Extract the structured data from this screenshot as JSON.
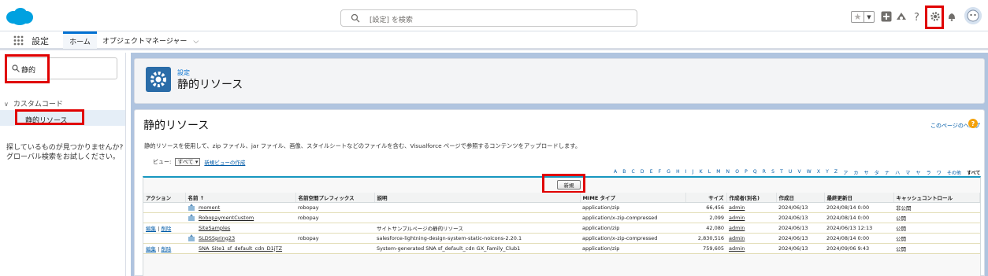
{
  "header": {
    "search_placeholder": "[設定] を検索"
  },
  "nav": {
    "app_name": "設定",
    "tabs": [
      {
        "label": "ホーム"
      },
      {
        "label": "オブジェクトマネージャー"
      }
    ]
  },
  "sidebar": {
    "quick_find_value": "静的",
    "section_label": "カスタムコード",
    "selected_item": "静的リソース",
    "help_text": "探しているものが見つかりませんか? グローバル検索をお試しください。"
  },
  "page_header": {
    "breadcrumb": "設定",
    "title": "静的リソース"
  },
  "main": {
    "title": "静的リソース",
    "help_link": "このページのヘルプ",
    "description": "静的リソースを使用して、zip ファイル、jar ファイル、画像、スタイルシートなどのファイルを含む、Visualforce ページで参照するコンテンツをアップロードします。",
    "view_label": "ビュー:",
    "view_value": "すべて",
    "new_view_link": "新規ビューの作成",
    "alphabet": [
      "A",
      "B",
      "C",
      "D",
      "E",
      "F",
      "G",
      "H",
      "I",
      "J",
      "K",
      "L",
      "M",
      "N",
      "O",
      "P",
      "Q",
      "R",
      "S",
      "T",
      "U",
      "V",
      "W",
      "X",
      "Y",
      "Z",
      "ア",
      "カ",
      "サ",
      "タ",
      "ナ",
      "ハ",
      "マ",
      "ヤ",
      "ラ",
      "ワ",
      "その他",
      "すべて"
    ],
    "new_button": "新規",
    "columns": [
      "アクション",
      "名前 ↑",
      "名前空間プレフィックス",
      "説明",
      "MIME タイプ",
      "サイズ",
      "作成者(別名)",
      "作成日",
      "最終更新日",
      "キャッシュコントロール"
    ],
    "rows": [
      {
        "edit": "",
        "del": "",
        "name": "moment",
        "ns": "robopay",
        "desc": "",
        "mime": "application/zip",
        "size": "66,456",
        "author": "admin",
        "created": "2024/06/13",
        "modified": "2024/08/14 0:00",
        "cache": "非公開"
      },
      {
        "edit": "",
        "del": "",
        "name": "RobopaymentCustom",
        "ns": "robopay",
        "desc": "",
        "mime": "application/x-zip-compressed",
        "size": "2,099",
        "author": "admin",
        "created": "2024/06/13",
        "modified": "2024/08/14 0:00",
        "cache": "公開"
      },
      {
        "edit": "編集",
        "del": "削除",
        "name": "SiteSamples",
        "ns": "",
        "desc": "サイトサンプルページの静的リソース",
        "mime": "application/zip",
        "size": "42,080",
        "author": "admin",
        "created": "2024/06/13",
        "modified": "2024/06/13 12:13",
        "cache": "公開"
      },
      {
        "edit": "",
        "del": "",
        "name": "SLDSSpring23",
        "ns": "robopay",
        "desc": "salesforce-lightning-design-system-static-noicons-2.20.1",
        "mime": "application/x-zip-compressed",
        "size": "2,830,516",
        "author": "admin",
        "created": "2024/06/13",
        "modified": "2024/08/14 0:00",
        "cache": "公開"
      },
      {
        "edit": "編集",
        "del": "削除",
        "name": "SNA_Site1_sf_default_cdn_D1jTZ",
        "ns": "",
        "desc": "System-generated SNA sf_default_cdn GX_Family_Club1",
        "mime": "application/zip",
        "size": "759,605",
        "author": "admin",
        "created": "2024/06/13",
        "modified": "2024/09/06 9:43",
        "cache": "公開"
      }
    ]
  }
}
